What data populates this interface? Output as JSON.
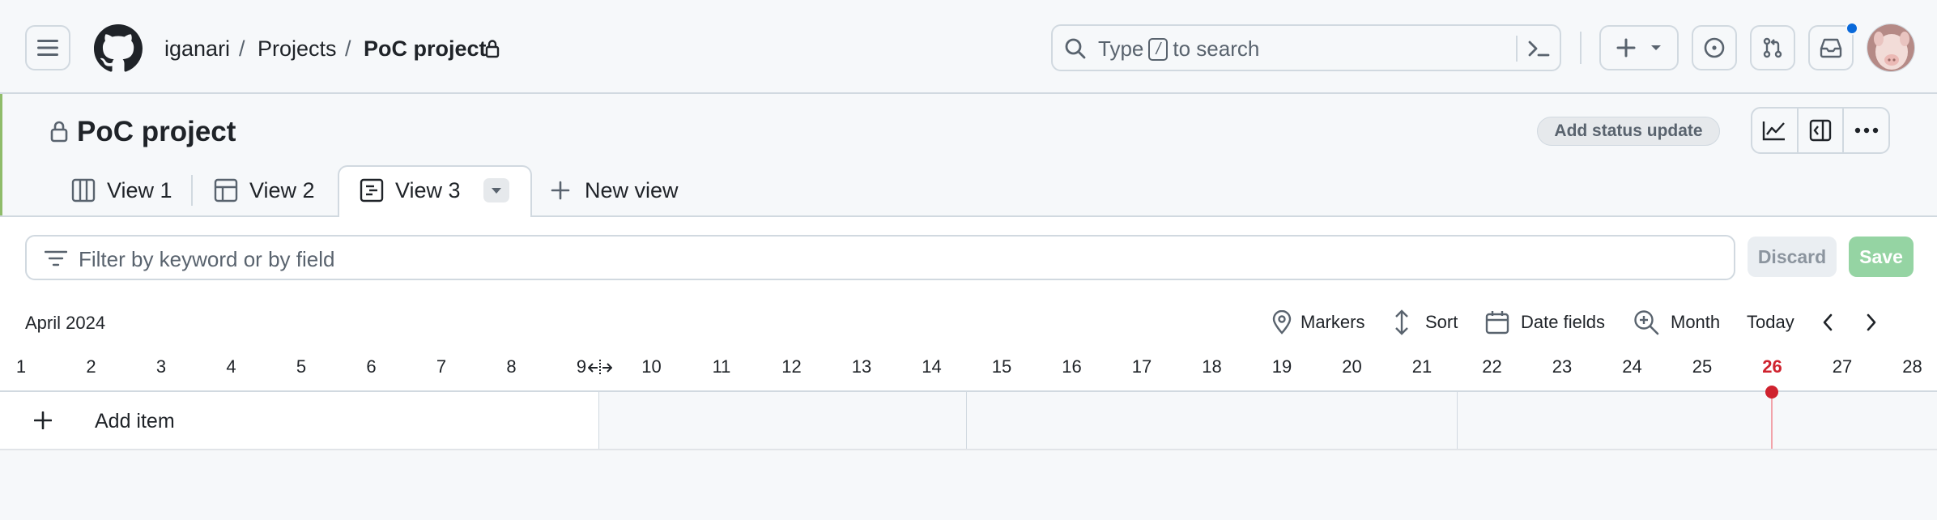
{
  "breadcrumb": {
    "owner": "iganari",
    "separator": "/",
    "section": "Projects",
    "project": "PoC project"
  },
  "search": {
    "prefix": "Type",
    "key": "/",
    "suffix": "to search"
  },
  "project": {
    "title": "PoC project",
    "status_button": "Add status update"
  },
  "tabs": [
    {
      "label": "View 1",
      "icon": "board-icon"
    },
    {
      "label": "View 2",
      "icon": "table-icon"
    },
    {
      "label": "View 3",
      "icon": "roadmap-icon",
      "active": true
    }
  ],
  "new_view_label": "New view",
  "filter": {
    "placeholder": "Filter by keyword or by field",
    "discard_label": "Discard",
    "save_label": "Save"
  },
  "roadmap": {
    "month": "April 2024",
    "markers_label": "Markers",
    "sort_label": "Sort",
    "date_fields_label": "Date fields",
    "zoom_label": "Month",
    "today_label": "Today",
    "days": [
      "1",
      "2",
      "3",
      "4",
      "5",
      "6",
      "7",
      "8",
      "9",
      "10",
      "11",
      "12",
      "13",
      "14",
      "15",
      "16",
      "17",
      "18",
      "19",
      "20",
      "21",
      "22",
      "23",
      "24",
      "25",
      "26",
      "27",
      "28"
    ],
    "today": "26"
  },
  "add_item_label": "Add item",
  "colors": {
    "accent_green": "#95d4a3",
    "today_red": "#cf222e",
    "notification_blue": "#0969da"
  }
}
